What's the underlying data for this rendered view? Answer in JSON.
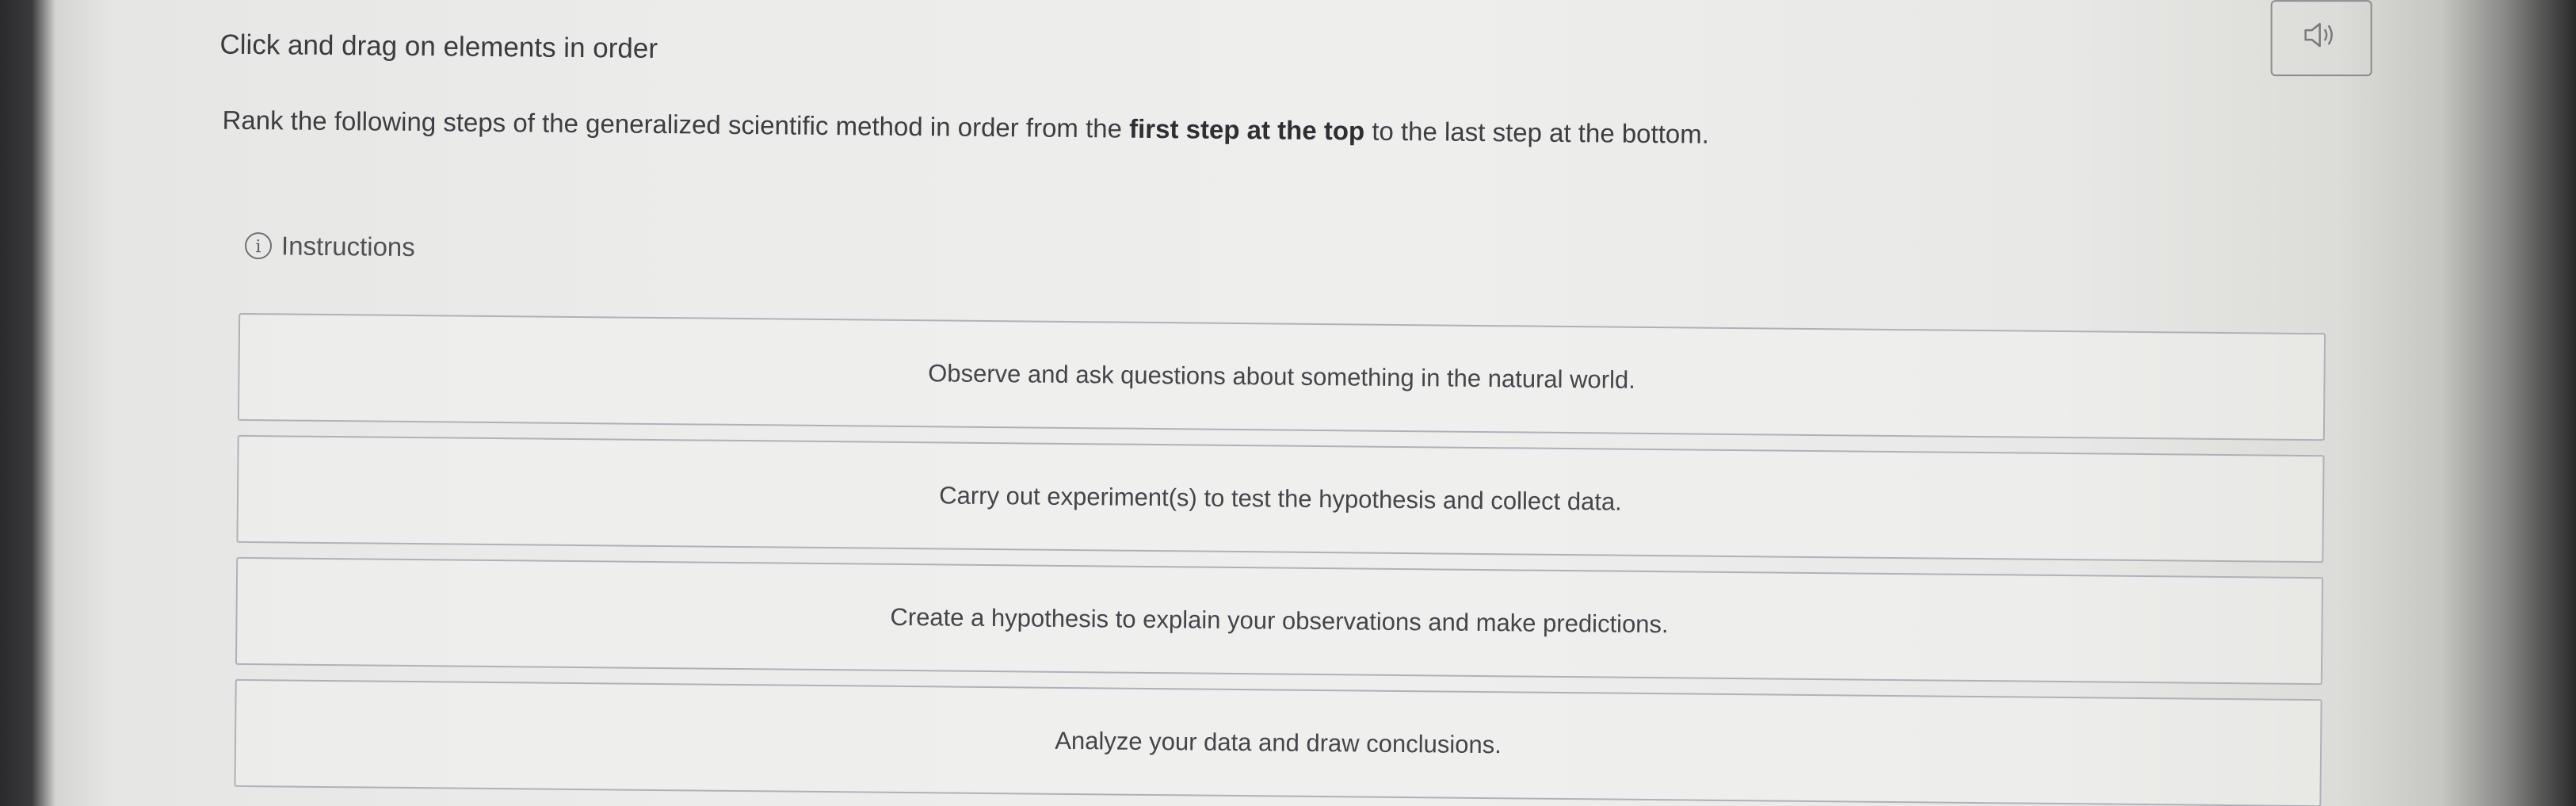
{
  "header": {
    "title": "Click and drag on elements in order"
  },
  "prompt": {
    "text_before": "Rank the following steps of the generalized scientific method in order from the ",
    "text_bold": "first step at the top",
    "text_after": " to the last step at the bottom."
  },
  "audio_button": {
    "icon": "speaker-icon"
  },
  "instructions": {
    "label": "Instructions",
    "icon_glyph": "i"
  },
  "rank_items": [
    {
      "label": "Observe and ask questions about something in the natural world."
    },
    {
      "label": "Carry out experiment(s) to test the hypothesis and collect data."
    },
    {
      "label": "Create a hypothesis to explain your observations and make predictions."
    },
    {
      "label": "Analyze your data and draw conclusions."
    }
  ]
}
